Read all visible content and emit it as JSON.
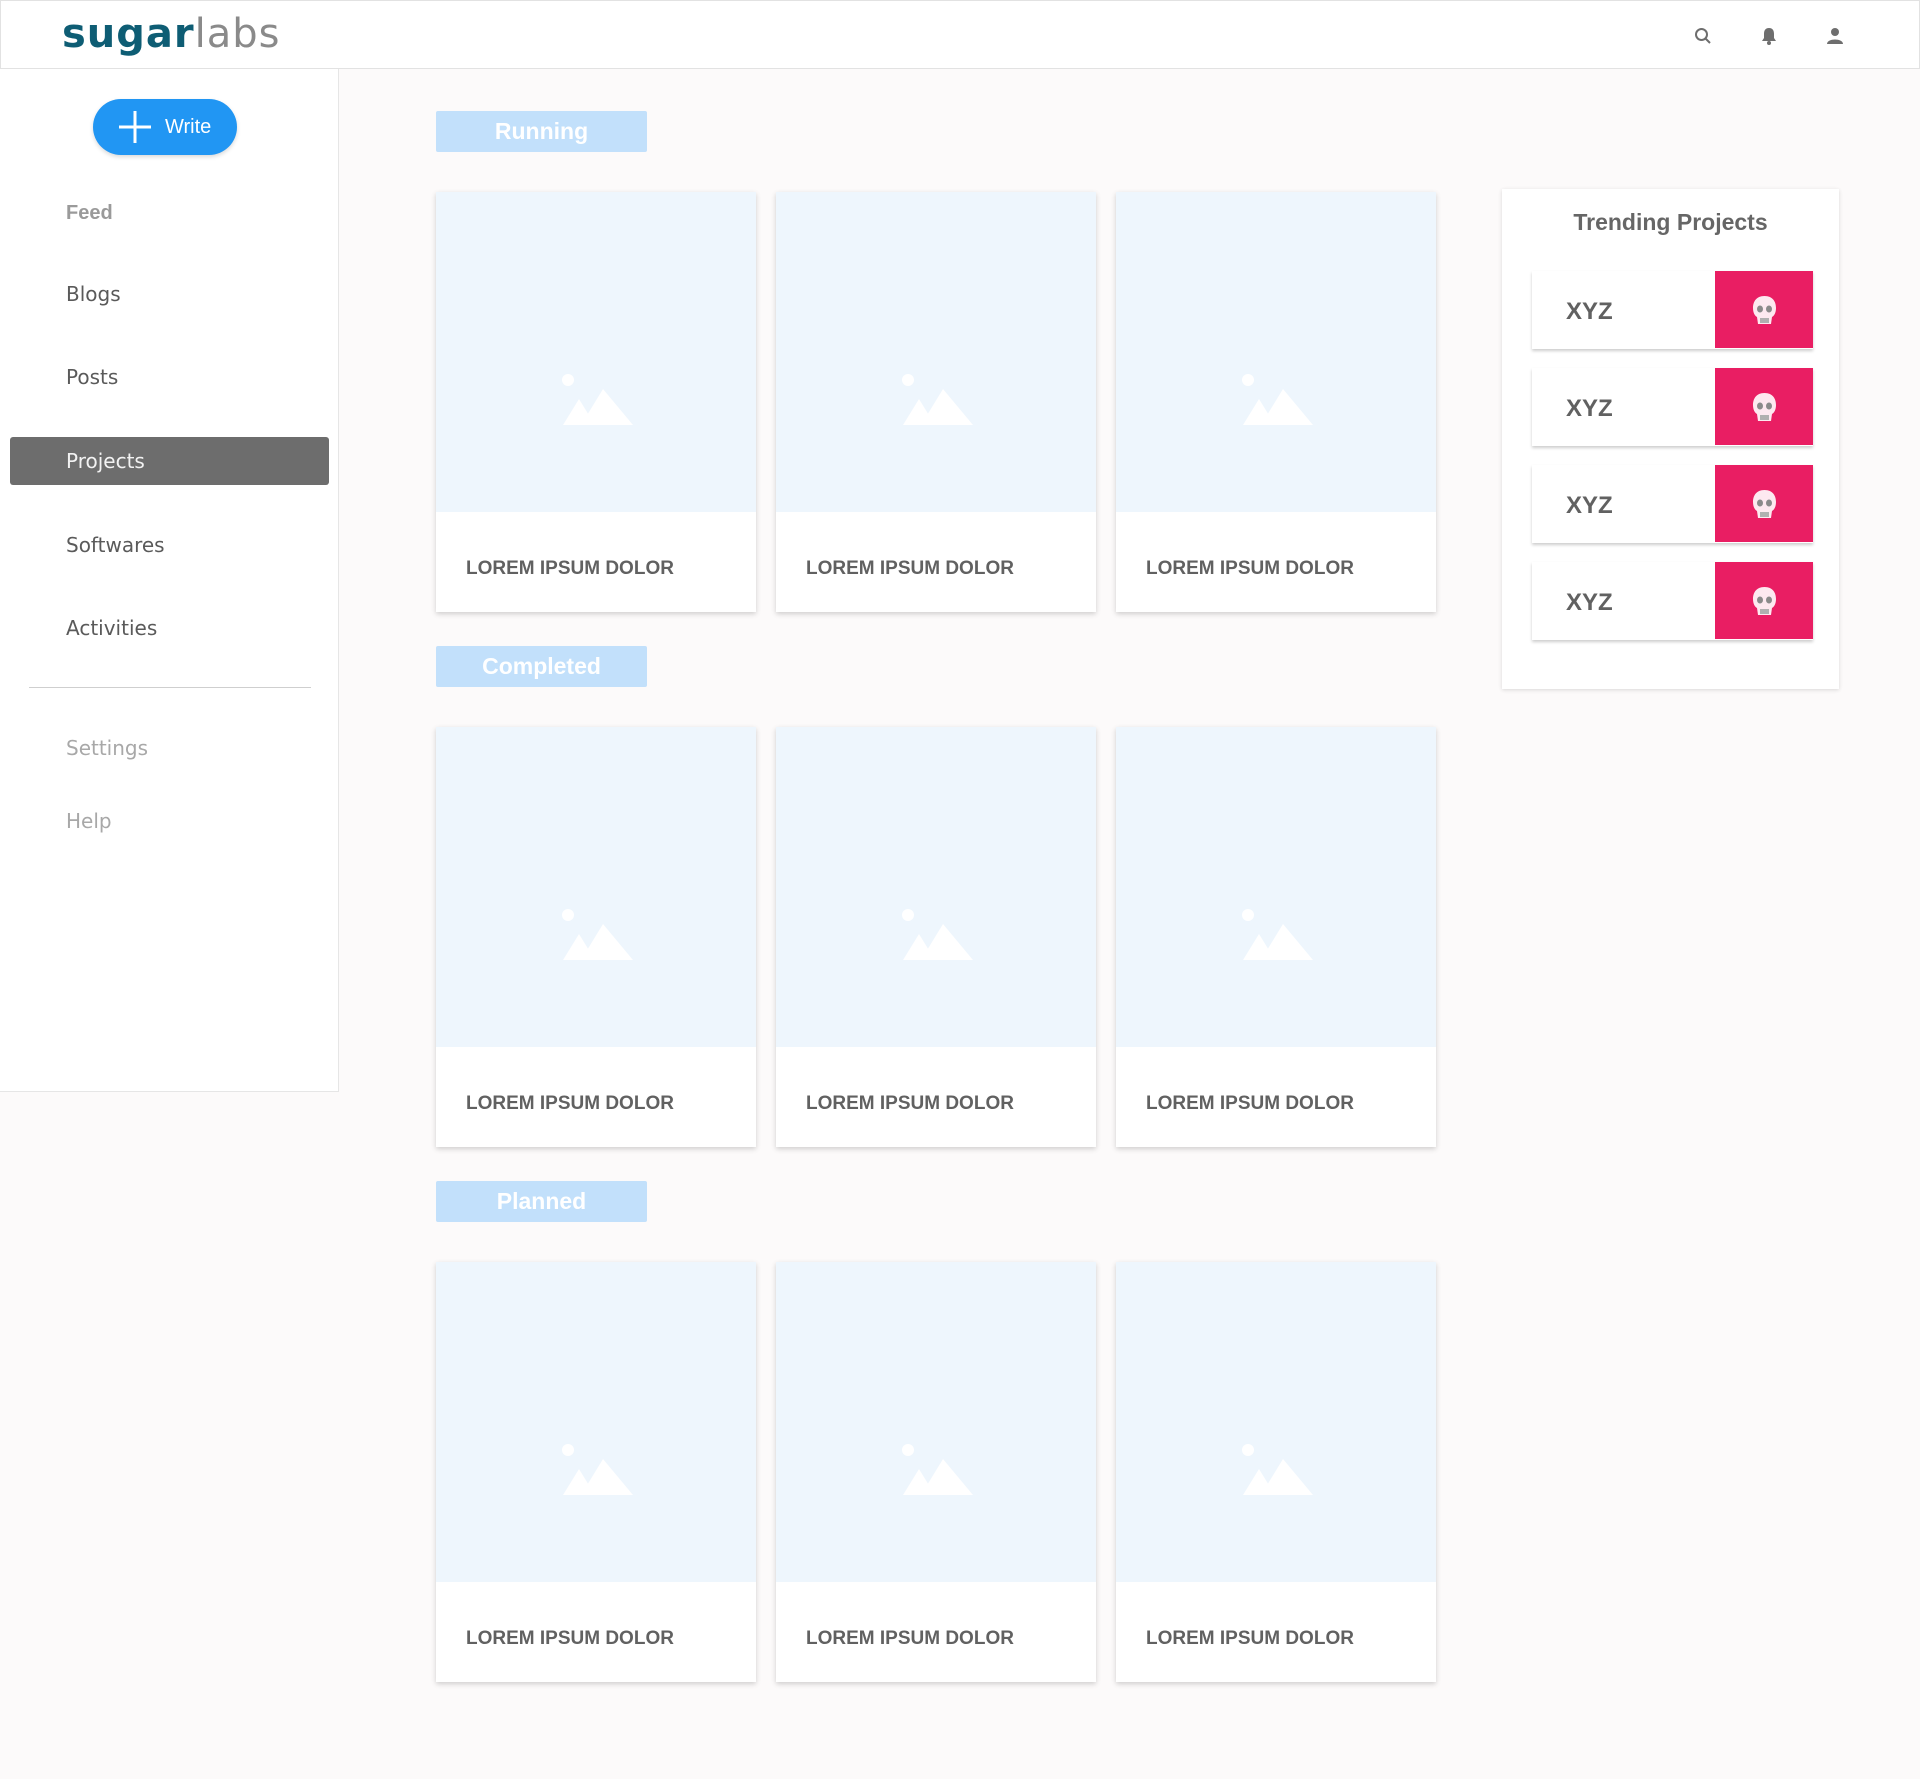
{
  "header": {
    "logo_part1": "sugar",
    "logo_part2": "labs",
    "icons": [
      "search-icon",
      "bell-icon",
      "user-icon"
    ]
  },
  "sidebar": {
    "write_label": "Write",
    "items": [
      {
        "label": "Feed"
      },
      {
        "label": "Blogs"
      },
      {
        "label": "Posts"
      },
      {
        "label": "Projects",
        "active": true
      },
      {
        "label": "Softwares"
      },
      {
        "label": "Activities"
      },
      {
        "label": "Settings"
      },
      {
        "label": "Help"
      }
    ]
  },
  "sections": [
    {
      "label": "Running",
      "cards": [
        "LOREM IPSUM DOLOR",
        "LOREM IPSUM DOLOR",
        "LOREM IPSUM DOLOR"
      ]
    },
    {
      "label": "Completed",
      "cards": [
        "LOREM IPSUM DOLOR",
        "LOREM IPSUM DOLOR",
        "LOREM IPSUM DOLOR"
      ]
    },
    {
      "label": "Planned",
      "cards": [
        "LOREM IPSUM DOLOR",
        "LOREM IPSUM DOLOR",
        "LOREM IPSUM DOLOR"
      ]
    }
  ],
  "trending": {
    "title": "Trending Projects",
    "items": [
      {
        "name": "XYZ"
      },
      {
        "name": "XYZ"
      },
      {
        "name": "XYZ"
      },
      {
        "name": "XYZ"
      }
    ]
  },
  "colors": {
    "accent": "#2196f3",
    "active_nav": "#6d6d6d",
    "section_tag": "#c2e0fb",
    "trend_thumb": "#e91e63"
  }
}
